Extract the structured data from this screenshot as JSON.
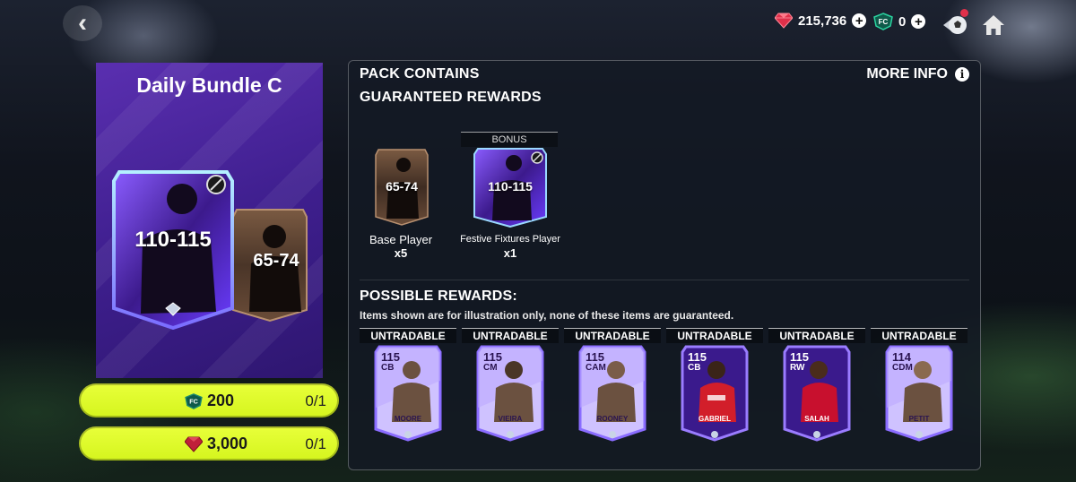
{
  "nav": {
    "back_glyph": "‹"
  },
  "currencies": [
    {
      "name": "gems",
      "icon": "ruby-gem-icon",
      "amount": "215,736"
    },
    {
      "name": "fc-points",
      "icon": "fc-points-icon",
      "amount": "0"
    }
  ],
  "pack": {
    "title": "Daily Bundle C",
    "main_card_rating": "110-115",
    "secondary_card_rating": "65-74"
  },
  "contents": {
    "header": "PACK CONTAINS",
    "more_info_label": "MORE INFO",
    "guaranteed_header": "GUARANTEED REWARDS",
    "guaranteed": [
      {
        "rating": "65-74",
        "name": "Base Player",
        "qty": "x5",
        "bonus": ""
      },
      {
        "rating": "110-115",
        "name": "Festive Fixtures Player",
        "qty": "x1",
        "bonus": "BONUS"
      }
    ],
    "possible_header": "POSSIBLE REWARDS:",
    "disclaimer": "Items shown are for illustration only, none of these items are guaranteed.",
    "untradable_label": "UNTRADABLE",
    "possible": [
      {
        "rating": "115",
        "position": "CB",
        "name": "MOORE",
        "style": "light"
      },
      {
        "rating": "115",
        "position": "CM",
        "name": "VIEIRA",
        "style": "light"
      },
      {
        "rating": "115",
        "position": "CAM",
        "name": "ROONEY",
        "style": "light"
      },
      {
        "rating": "115",
        "position": "CB",
        "name": "GABRIEL",
        "style": "dark"
      },
      {
        "rating": "115",
        "position": "RW",
        "name": "SALAH",
        "style": "dark"
      },
      {
        "rating": "114",
        "position": "CDM",
        "name": "PETIT",
        "style": "light"
      }
    ]
  },
  "purchase": [
    {
      "currency_icon": "fc-points-icon",
      "price": "200",
      "count": "0/1"
    },
    {
      "currency_icon": "ruby-gem-icon",
      "price": "3,000",
      "count": "0/1"
    }
  ],
  "colors": {
    "accent_button": "#dff92a",
    "pack_purple": "#4a24a0",
    "gem_red": "#e0304a",
    "fc_teal": "#2bd3a0"
  }
}
